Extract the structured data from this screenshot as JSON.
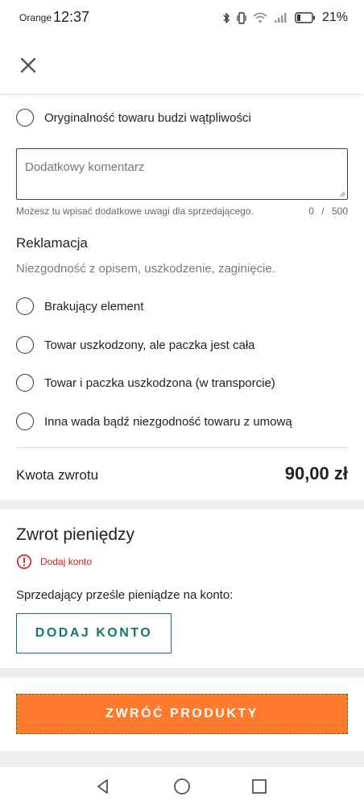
{
  "status_bar": {
    "carrier": "Orange",
    "time": "12:37",
    "battery_percent": "21%",
    "icons": [
      "bluetooth-icon",
      "vibrate-icon",
      "wifi-icon",
      "signal-icon",
      "battery-icon"
    ]
  },
  "header": {
    "close_icon": "close-icon"
  },
  "reasons_top": [
    {
      "label": "Oryginalność towaru budzi wątpliwości",
      "selected": false
    }
  ],
  "comment": {
    "placeholder": "Dodatkowy komentarz",
    "value": "",
    "hint": "Możesz tu wpisać dodatkowe uwagi dla sprzedającego.",
    "counter": "0 / 500"
  },
  "complaint": {
    "title": "Reklamacja",
    "description": "Niezgodność z opisem, uszkodzenie, zaginięcie.",
    "options": [
      {
        "label": "Brakujący element",
        "selected": false
      },
      {
        "label": "Towar uszkodzony, ale paczka jest cała",
        "selected": false
      },
      {
        "label": "Towar i paczka uszkodzona (w transporcie)",
        "selected": false
      },
      {
        "label": "Inna wada bądź niezgodność towaru z umową",
        "selected": false
      }
    ]
  },
  "refund": {
    "label": "Kwota zwrotu",
    "amount": "90,00 zł"
  },
  "money_return": {
    "title": "Zwrot pieniędzy",
    "warning": "Dodaj konto",
    "seller_text": "Sprzedający prześle pieniądze na konto:",
    "add_account_button": "DODAJ KONTO"
  },
  "return_button": "ZWRÓĆ PRODUKTY",
  "colors": {
    "accent_green": "#0d7a69",
    "cta_orange": "#ff7a2c",
    "warning_red": "#cc1f1f",
    "band_gray": "#efefef"
  },
  "nav_bar": {
    "buttons": [
      "back-icon",
      "home-icon",
      "recents-icon"
    ]
  }
}
